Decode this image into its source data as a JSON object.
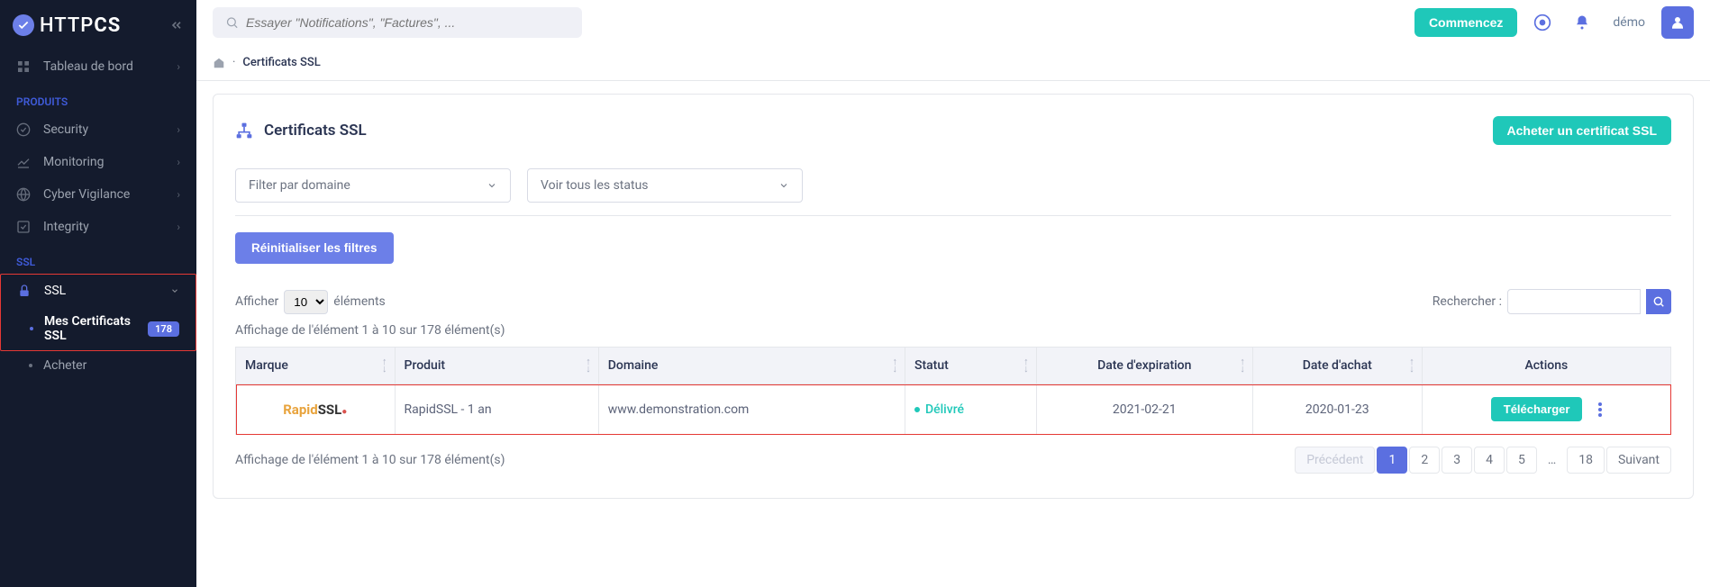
{
  "brand": {
    "prefix": "HTTP",
    "suffix": "CS"
  },
  "search": {
    "placeholder": "Essayer \"Notifications\", \"Factures\", ..."
  },
  "topbar": {
    "cta": "Commencez",
    "user": "démo"
  },
  "breadcrumb": {
    "current": "Certificats SSL"
  },
  "sidebar": {
    "dashboard": "Tableau de bord",
    "section_products": "PRODUITS",
    "security": "Security",
    "monitoring": "Monitoring",
    "cyber": "Cyber Vigilance",
    "integrity": "Integrity",
    "section_ssl": "SSL",
    "ssl": "SSL",
    "my_certs": "Mes Certificats SSL",
    "my_certs_count": "178",
    "buy": "Acheter"
  },
  "page": {
    "title": "Certificats SSL",
    "buy_btn": "Acheter un certificat SSL",
    "filter_domain": "Filter par domaine",
    "filter_status": "Voir tous les status",
    "reset": "Réinitialiser les filtres"
  },
  "table": {
    "show_prefix": "Afficher",
    "show_suffix": "éléments",
    "page_size": "10",
    "search_label": "Rechercher :",
    "info": "Affichage de l'élément 1 à 10 sur 178 élément(s)",
    "headers": {
      "brand": "Marque",
      "product": "Produit",
      "domain": "Domaine",
      "status": "Statut",
      "expiry": "Date d'expiration",
      "purchase": "Date d'achat",
      "actions": "Actions"
    },
    "rows": [
      {
        "brand": "RapidSSL",
        "product": "RapidSSL - 1 an",
        "domain": "www.demonstration.com",
        "status": "Délivré",
        "expiry": "2021-02-21",
        "purchase": "2020-01-23",
        "action": "Télécharger"
      }
    ]
  },
  "pagination": {
    "prev": "Précédent",
    "next": "Suivant",
    "pages": [
      "1",
      "2",
      "3",
      "4",
      "5"
    ],
    "last": "18"
  }
}
